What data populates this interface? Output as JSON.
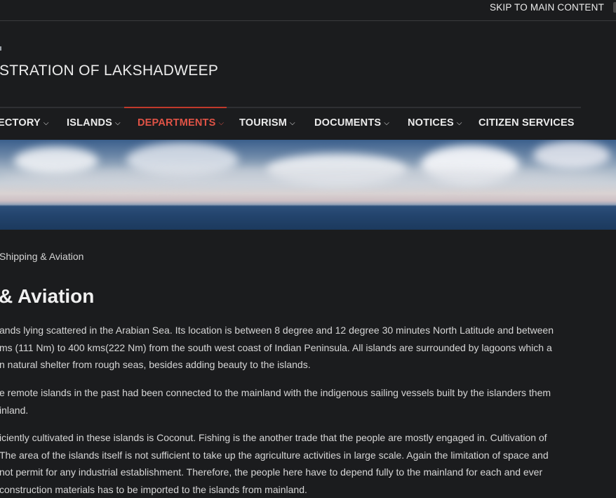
{
  "topbar": {
    "skip_link": "SKIP TO MAIN CONTENT"
  },
  "header": {
    "site_title": "STRATION OF LAKSHADWEEP"
  },
  "nav": {
    "items": [
      {
        "label": "ECTORY",
        "has_dropdown": true,
        "active": false
      },
      {
        "label": "ISLANDS",
        "has_dropdown": true,
        "active": false
      },
      {
        "label": "DEPARTMENTS",
        "has_dropdown": true,
        "active": true
      },
      {
        "label": "TOURISM",
        "has_dropdown": true,
        "active": false
      },
      {
        "label": "DOCUMENTS",
        "has_dropdown": true,
        "active": false
      },
      {
        "label": "NOTICES",
        "has_dropdown": true,
        "active": false
      },
      {
        "label": "CITIZEN SERVICES",
        "has_dropdown": false,
        "active": false
      }
    ],
    "chevron_glyph": "⌵",
    "active_color": "#e05346"
  },
  "breadcrumb": {
    "current": "Shipping & Aviation"
  },
  "main": {
    "title": "& Aviation",
    "paragraphs": [
      {
        "lines": [
          "ands lying scattered in the Arabian Sea.  Its location is between 8 degree and 12 degree 30 minutes North Latitude and between",
          "ms (111 Nm) to 400 kms(222 Nm) from the south west coast of Indian Peninsula. All islands are surrounded by lagoons which a",
          "n natural shelter from rough seas, besides adding beauty to the islands."
        ]
      },
      {
        "lines": [
          "e remote islands in the past had been connected to the mainland with the indigenous sailing vessels built by the islanders them",
          "inland."
        ]
      },
      {
        "lines": [
          "iciently cultivated in these islands is Coconut. Fishing is the another trade that the people are mostly engaged in.  Cultivation of",
          "The area of the islands itself is not sufficient to take up the agriculture activities in large scale.  Again the limitation of space and",
          " not permit for any industrial establishment.  Therefore, the people here have to depend fully to the mainland for each and ever",
          "construction materials has to be imported to the islands from mainland."
        ]
      }
    ]
  }
}
